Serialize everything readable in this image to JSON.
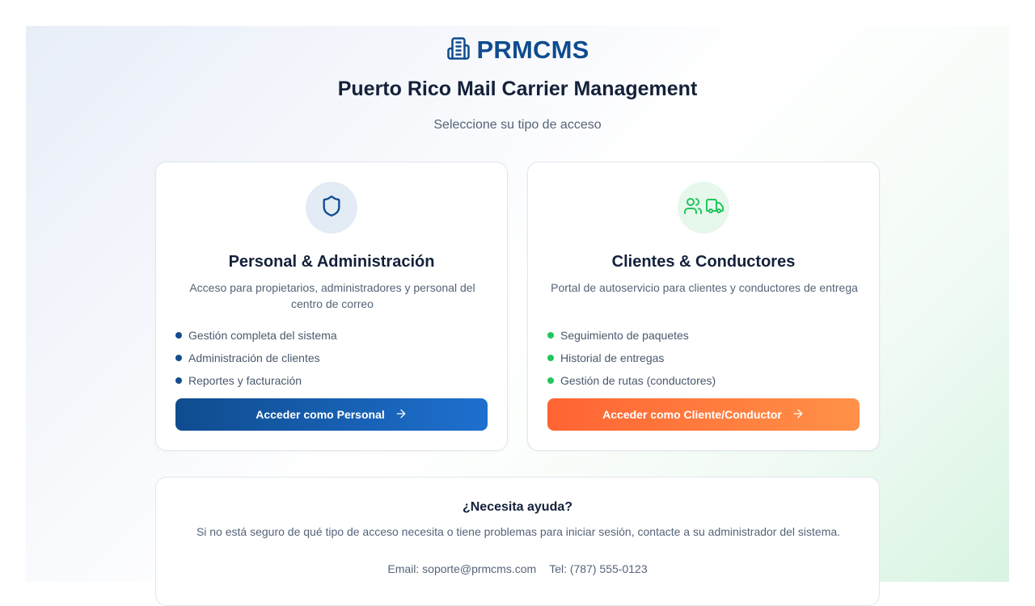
{
  "brand": {
    "name": "PRMCMS",
    "icon": "building-icon",
    "color": "#0f4c8f"
  },
  "header": {
    "title": "Puerto Rico Mail Carrier Management",
    "subtitle": "Seleccione su tipo de acceso"
  },
  "cards": [
    {
      "icon": "shield-icon",
      "title": "Personal & Administración",
      "description": "Acceso para propietarios, administradores y personal del centro de correo",
      "features": [
        "Gestión completa del sistema",
        "Administración de clientes",
        "Reportes y facturación"
      ],
      "button_label": "Acceder como Personal",
      "accent": "#0f4c8f"
    },
    {
      "icons": [
        "users-icon",
        "truck-icon"
      ],
      "title": "Clientes & Conductores",
      "description": "Portal de autoservicio para clientes y conductores de entrega",
      "features": [
        "Seguimiento de paquetes",
        "Historial de entregas",
        "Gestión de rutas (conductores)"
      ],
      "button_label": "Acceder como Cliente/Conductor",
      "accent": "#22c55e",
      "button_color": "#ff6433"
    }
  ],
  "help": {
    "title": "¿Necesita ayuda?",
    "text": "Si no está seguro de qué tipo de acceso necesita o tiene problemas para iniciar sesión, contacte a su administrador del sistema.",
    "email": "Email: soporte@prmcms.com",
    "phone": "Tel: (787) 555-0123"
  }
}
